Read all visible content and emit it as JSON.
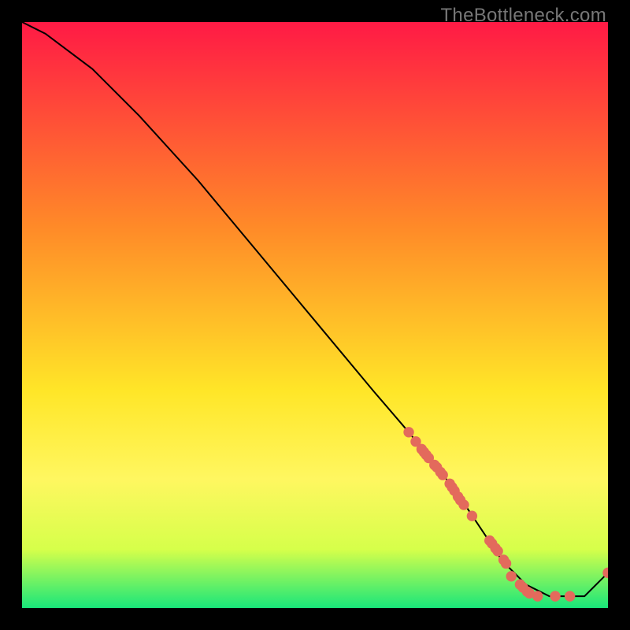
{
  "watermark": "TheBottleneck.com",
  "colors": {
    "red": "#ff1a45",
    "orange": "#ff8a28",
    "yellow": "#ffe628",
    "yellow2": "#fff760",
    "lime": "#d6ff4a",
    "green": "#19e67a",
    "curve": "#000000",
    "marker": "#e36a5c",
    "bg": "#000000"
  },
  "chart_data": {
    "type": "line",
    "title": "",
    "xlabel": "",
    "ylabel": "",
    "xlim": [
      0,
      100
    ],
    "ylim": [
      0,
      100
    ],
    "curve": {
      "x": [
        0,
        4,
        8,
        12,
        20,
        30,
        40,
        50,
        60,
        66,
        70,
        74,
        78,
        82,
        84,
        86,
        88,
        90,
        92,
        94,
        96,
        98,
        100
      ],
      "y": [
        100,
        98,
        95,
        92,
        84,
        73,
        61,
        49,
        37,
        30,
        25,
        20,
        14,
        8,
        6,
        4,
        3,
        2,
        2,
        2,
        2,
        4,
        6
      ]
    },
    "markers": {
      "x": [
        66.0,
        67.2,
        68.2,
        68.6,
        69.0,
        69.4,
        70.4,
        70.8,
        71.4,
        71.8,
        73.0,
        73.4,
        73.8,
        74.4,
        74.8,
        75.4,
        76.8,
        79.8,
        80.2,
        80.8,
        81.2,
        82.2,
        82.6,
        83.5,
        85.0,
        85.5,
        86.2,
        86.6,
        88.0,
        91.0,
        93.5,
        100.0
      ],
      "y": [
        30.0,
        28.4,
        27.1,
        26.6,
        26.1,
        25.6,
        24.4,
        24.0,
        23.2,
        22.7,
        21.2,
        20.6,
        20.0,
        19.0,
        18.4,
        17.6,
        15.7,
        11.5,
        11.0,
        10.2,
        9.7,
        8.2,
        7.6,
        5.4,
        4.0,
        3.5,
        2.8,
        2.5,
        2.0,
        2.0,
        2.0,
        6.0
      ]
    }
  }
}
